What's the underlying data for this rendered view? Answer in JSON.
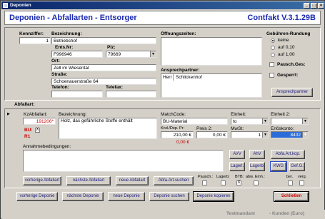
{
  "window": {
    "title": "Deponien"
  },
  "header": {
    "title": "Deponien - Abfallarten - Entsorger",
    "version": "Contfakt V.3.1.29B"
  },
  "deponie": {
    "kennziffer_label": "Kennziffer:",
    "kennziffer": "1",
    "bezeichnung_label": "Bezeichnung:",
    "bezeichnung": "Betriebshof",
    "ents_nr_label": "Ents.Nr:",
    "ents_nr": "F996946",
    "plz_label": "Plz:",
    "plz": "79669",
    "ort_label": "Ort:",
    "ort": "Zell im Wiesental",
    "strasse_label": "Straße:",
    "strasse": "Schoenauerstraße 64",
    "telefon_label": "Telefon:",
    "telefon": "",
    "telefax_label": "Telefax:",
    "telefax": "",
    "oeffnungszeiten_label": "Öffnungszeiten:",
    "oeffnungszeiten": "",
    "ansprechpartner_label": "Ansprechpartner:",
    "ansprechpartner_anrede": "Herr",
    "ansprechpartner_name": "Schlickenhof",
    "ansprechpartner_button": "Ansprechpartner"
  },
  "gebuehren": {
    "label": "Gebühren-Rundung",
    "options": [
      "keine",
      "auf 0,10",
      "auf 1,00"
    ],
    "selected": 0,
    "pausch_label": "Pausch.Ges:",
    "gesperrt_label": "Gesperrt:"
  },
  "abfallart": {
    "section_label": "Abfallart:",
    "kz_label": "KzAbfallart:",
    "kz": "191206*",
    "bu_label": "BU:",
    "bu_check": "X",
    "r1_label": "R1",
    "bezeichnung_label": "Bezeichnung:",
    "bezeichnung": "Holz, das gefährliche Stoffe enthält",
    "matchcode_label": "MatchCode:",
    "matchcode": "BU-Material",
    "knd_dep_label": "Knd./Dep. Pr:",
    "knd_dep_pr": "210,00 €",
    "preis2_label": "Preis 2:",
    "preis2": "0,00 €",
    "third_price": "0,00 €",
    "einheit_label": "Einheit:",
    "einheit": "to",
    "einheit2_label": "Einheit 2:",
    "einheit2": "",
    "mwst_label": "MwSt:",
    "mwst": "1",
    "erloeskonto_label": "Erlöskonto:",
    "erloeskonto": "8402",
    "annahme_label": "Annahmebedingungen:",
    "annahme": ""
  },
  "buttons": {
    "avv": "AVV",
    "ahv": "AhV",
    "abfa_art_kop": "Abfa.Art.kop.",
    "lagerl": "Lagerl.",
    "lagerb": "Lagerb.",
    "kwg": "KWG",
    "gef_g": "Gef.G.",
    "vorherige_abfallart": "vorherige Abfallart",
    "naechste_abfallart": "nächste Abfallart",
    "neue_abfallart": "neue Abfallart",
    "abfa_art_suchen": "Abfa.Art.suchen",
    "vorherige_deponie": "vorherige Deponie",
    "naechste_deponie": "nächste Deponie",
    "neue_deponie": "neue Deponie",
    "deponie_suchen": "Deponie suchen",
    "deponie_kopieren": "Deponie kopieren",
    "schliessen": "Schließen"
  },
  "flags": {
    "pausch_label": "Pausch.:",
    "lagerb_label": "Lagerb:",
    "btb_label": "BTB:",
    "abw_einh_label": "abw. Einh.:",
    "ber_label": "ber.",
    "verg_label": "verg.",
    "btb_check": "X"
  },
  "status": {
    "mandant": "Testmandant",
    "kunden": "- Kunden (Euro)"
  }
}
